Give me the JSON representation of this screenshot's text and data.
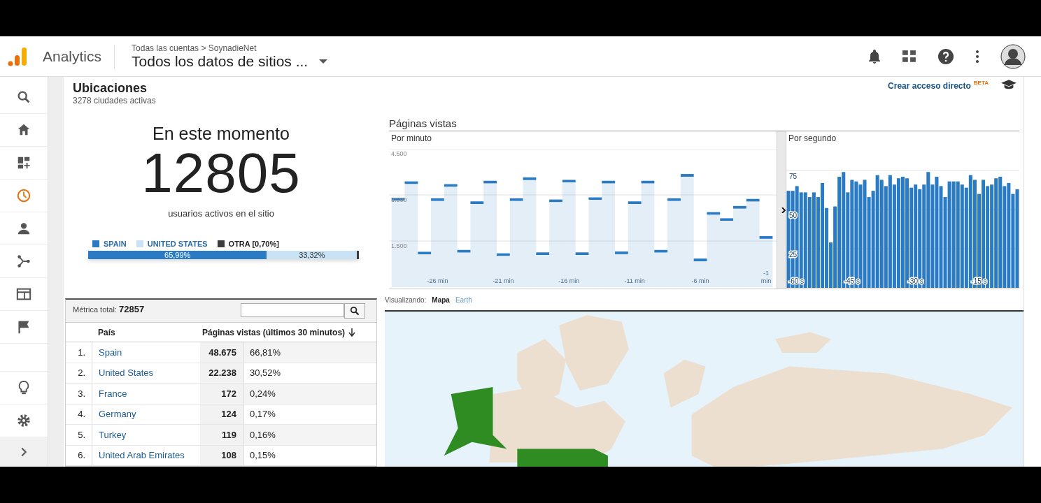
{
  "header": {
    "product": "Analytics",
    "breadcrumb": "Todas las cuentas > SoynadieNet",
    "property": "Todos los datos de sitios ..."
  },
  "sidebar": {
    "items": [
      {
        "selected": false
      },
      {
        "selected": false
      },
      {
        "selected": false
      },
      {
        "selected": true
      },
      {
        "selected": false
      },
      {
        "selected": false
      },
      {
        "selected": false
      },
      {
        "selected": false
      },
      {
        "selected": false
      },
      {
        "selected": false
      },
      {
        "selected": false
      }
    ]
  },
  "page": {
    "title": "Ubicaciones",
    "subtitle": "3278 ciudades activas",
    "shortcut": "Crear acceso directo",
    "shortcut_badge": "BETA"
  },
  "now": {
    "heading": "En este momento",
    "count": "12805",
    "caption": "usuarios activos en el sitio"
  },
  "share_bar": {
    "segments": [
      {
        "label": "SPAIN",
        "color": "#2a7bc4",
        "level": 0.6599,
        "text": "65,99%"
      },
      {
        "label": "UNITED STATES",
        "color": "#c9e3f4",
        "level": 0.3332,
        "text": "33,32%"
      },
      {
        "label": "OTRA [0,70%]",
        "color": "#3c3c3c",
        "level": 0.007
      }
    ]
  },
  "pageviews": {
    "title": "Páginas vistas",
    "per_minute": {
      "label": "Por minuto",
      "chart_data": {
        "type": "bar",
        "x": [
          -29,
          -28,
          -27,
          -26,
          -25,
          -24,
          -23,
          -22,
          -21,
          -20,
          -19,
          -18,
          -17,
          -16,
          -15,
          -14,
          -13,
          -12,
          -11,
          -10,
          -9,
          -8,
          -7,
          -6,
          -5,
          -4,
          -3,
          -2,
          -1
        ],
        "series": [
          {
            "color": "#2a7bc4",
            "values": [
              2900,
              3440,
              1150,
              2890,
              3350,
              1210,
              2790,
              3460,
              1100,
              2890,
              3570,
              1130,
              2850,
              3490,
              1130,
              2920,
              3460,
              1160,
              2790,
              3460,
              1210,
              2890,
              3680,
              930,
              2440,
              2240,
              2640,
              2870,
              1660
            ]
          }
        ],
        "xlim": [
          -29.7,
          -0.2
        ],
        "ylim": [
          0,
          4500
        ],
        "grid": true,
        "yticks": [
          {
            "value": 1500,
            "label": "1.500"
          },
          {
            "value": 3000,
            "label": "3.000"
          },
          {
            "value": 4500,
            "label": "4.500"
          }
        ],
        "xticks": [
          {
            "value": -26,
            "label": "-26 min"
          },
          {
            "value": -21,
            "label": "-21 min"
          },
          {
            "value": -16,
            "label": "-16 min"
          },
          {
            "value": -11,
            "label": "-11 min"
          },
          {
            "value": -6,
            "label": "-6 min"
          },
          {
            "value": -1,
            "label": "-1 min"
          }
        ]
      }
    },
    "per_second": {
      "label": "Por segundo",
      "chart_data": {
        "type": "bar",
        "x": [
          -60,
          -59,
          -58,
          -57,
          -56,
          -55,
          -54,
          -53,
          -52,
          -51,
          -50,
          -49,
          -48,
          -47,
          -46,
          -45,
          -44,
          -43,
          -42,
          -41,
          -40,
          -39,
          -38,
          -37,
          -36,
          -35,
          -34,
          -33,
          -32,
          -31,
          -30,
          -29,
          -28,
          -27,
          -26,
          -25,
          -24,
          -23,
          -22,
          -21,
          -20,
          -19,
          -18,
          -17,
          -16,
          -15,
          -14,
          -13,
          -12,
          -11,
          -10,
          -9,
          -8,
          -7,
          -6
        ],
        "series": [
          {
            "color": "#2a7bc4",
            "values": [
              62,
              62,
              65,
              61,
              61,
              58,
              61,
              58,
              67,
              51,
              29,
              52,
              71,
              74,
              61,
              69,
              68,
              66,
              69,
              58,
              62,
              72,
              69,
              65,
              72,
              66,
              70,
              71,
              70,
              64,
              66,
              63,
              66,
              74,
              66,
              71,
              65,
              58,
              68,
              68,
              68,
              66,
              64,
              72,
              69,
              60,
              69,
              65,
              66,
              70,
              71,
              65,
              67,
              60,
              63
            ]
          }
        ],
        "xlim": [
          -60.5,
          -5.5
        ],
        "ylim": [
          0,
          100
        ],
        "grid": true,
        "yticks": [
          25,
          50,
          75
        ],
        "xticks": [
          {
            "value": -60,
            "label": "-60 s"
          },
          {
            "value": -45,
            "label": "-45 s"
          },
          {
            "value": -30,
            "label": "-30 s"
          },
          {
            "value": -15,
            "label": "-15 s"
          }
        ]
      }
    }
  },
  "table": {
    "total_label": "Métrica total:",
    "total": "72857",
    "columns": [
      "País",
      "Páginas vistas (últimos 30 minutos)"
    ],
    "rows": [
      {
        "rank": "1.",
        "country": "Spain",
        "views": "48.675",
        "share": "66,81%"
      },
      {
        "rank": "2.",
        "country": "United States",
        "views": "22.238",
        "share": "30,52%"
      },
      {
        "rank": "3.",
        "country": "France",
        "views": "172",
        "share": "0,24%"
      },
      {
        "rank": "4.",
        "country": "Germany",
        "views": "124",
        "share": "0,17%"
      },
      {
        "rank": "5.",
        "country": "Turkey",
        "views": "119",
        "share": "0,16%"
      },
      {
        "rank": "6.",
        "country": "United Arab Emirates",
        "views": "108",
        "share": "0,15%"
      }
    ]
  },
  "map_view": {
    "label": "Visualizando:",
    "tabs": [
      {
        "label": "Mapa",
        "selected": true
      },
      {
        "label": "Earth",
        "selected": false
      }
    ]
  }
}
